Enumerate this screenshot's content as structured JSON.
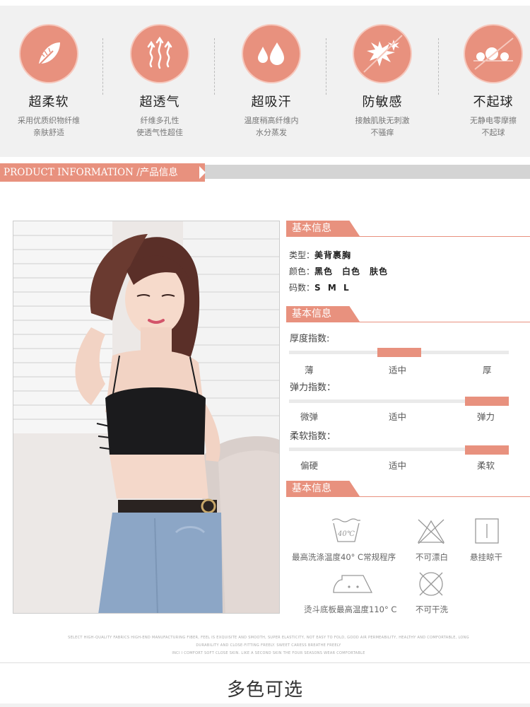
{
  "features": [
    {
      "icon": "feather-icon",
      "title": "超柔软",
      "desc1": "采用优质织物纤维",
      "desc2": "亲肤舒适"
    },
    {
      "icon": "airflow-icon",
      "title": "超透气",
      "desc1": "纤维多孔性",
      "desc2": "使透气性超佳"
    },
    {
      "icon": "water-drops-icon",
      "title": "超吸汗",
      "desc1": "温度稍高纤维内",
      "desc2": "水分蒸发"
    },
    {
      "icon": "no-irritation-icon",
      "title": "防敏感",
      "desc1": "接触肌肤无刺激",
      "desc2": "不骚痒"
    },
    {
      "icon": "no-pilling-icon",
      "title": "不起球",
      "desc1": "无静电零摩擦",
      "desc2": "不起球"
    }
  ],
  "product_info_title": "PRODUCT INFORMATION /产品信息",
  "basic_info": {
    "heading": "基本信息",
    "type_label": "类型：",
    "type_value": "美背裹胸",
    "color_label": "颜色：",
    "color_value": "黑色　白色　肤色",
    "size_label": "码数：",
    "size_value": "S M L"
  },
  "indices": {
    "heading": "基本信息",
    "thickness": {
      "title": "厚度指数:",
      "ticks": [
        "薄",
        "适中",
        "厚"
      ],
      "level": 0.5
    },
    "elasticity": {
      "title": "弹力指数：",
      "ticks": [
        "微弹",
        "适中",
        "弹力"
      ],
      "level": 1.0
    },
    "softness": {
      "title": "柔软指数：",
      "ticks": [
        "偏硬",
        "适中",
        "柔软"
      ],
      "level": 1.0
    }
  },
  "care": {
    "heading": "基本信息",
    "wash_temp": "40℃",
    "items": [
      {
        "icon": "wash-tub-icon",
        "label": "最高洗涤温度40° C常规程序"
      },
      {
        "icon": "no-bleach-icon",
        "label": "不可漂白"
      },
      {
        "icon": "hang-dry-icon",
        "label": "悬挂晾干"
      },
      {
        "icon": "iron-icon",
        "label": "烫斗底板最高温度110° C"
      },
      {
        "icon": "no-dry-clean-icon",
        "label": "不可干洗"
      }
    ]
  },
  "english_lines": [
    "SELECT HIGH-QUALITY FABRICS HIGH-END MANUFACTURING FIBER, FEEL IS EXQUISITE AND SMOOTH, SUPER ELASTICITY, NOT EASY TO FOLD, GOOD AIR PERMEABILITY, HEALTHY AND COMFORTABLE, LONG",
    "DURABILITY AND CLOSE-FITTING FREELY.    SWEET CARESS BREATHE FREELY",
    "INCI I COMFORT SOFT CLOSE SKIN. LIKE A SECOND SKIN THE FOUR SEASONS WEAR COMFORTABLE"
  ],
  "footer_title": "多色可选",
  "colors": {
    "accent": "#e8917e",
    "band": "#f1f1f1",
    "bar": "#d4d4d4"
  }
}
